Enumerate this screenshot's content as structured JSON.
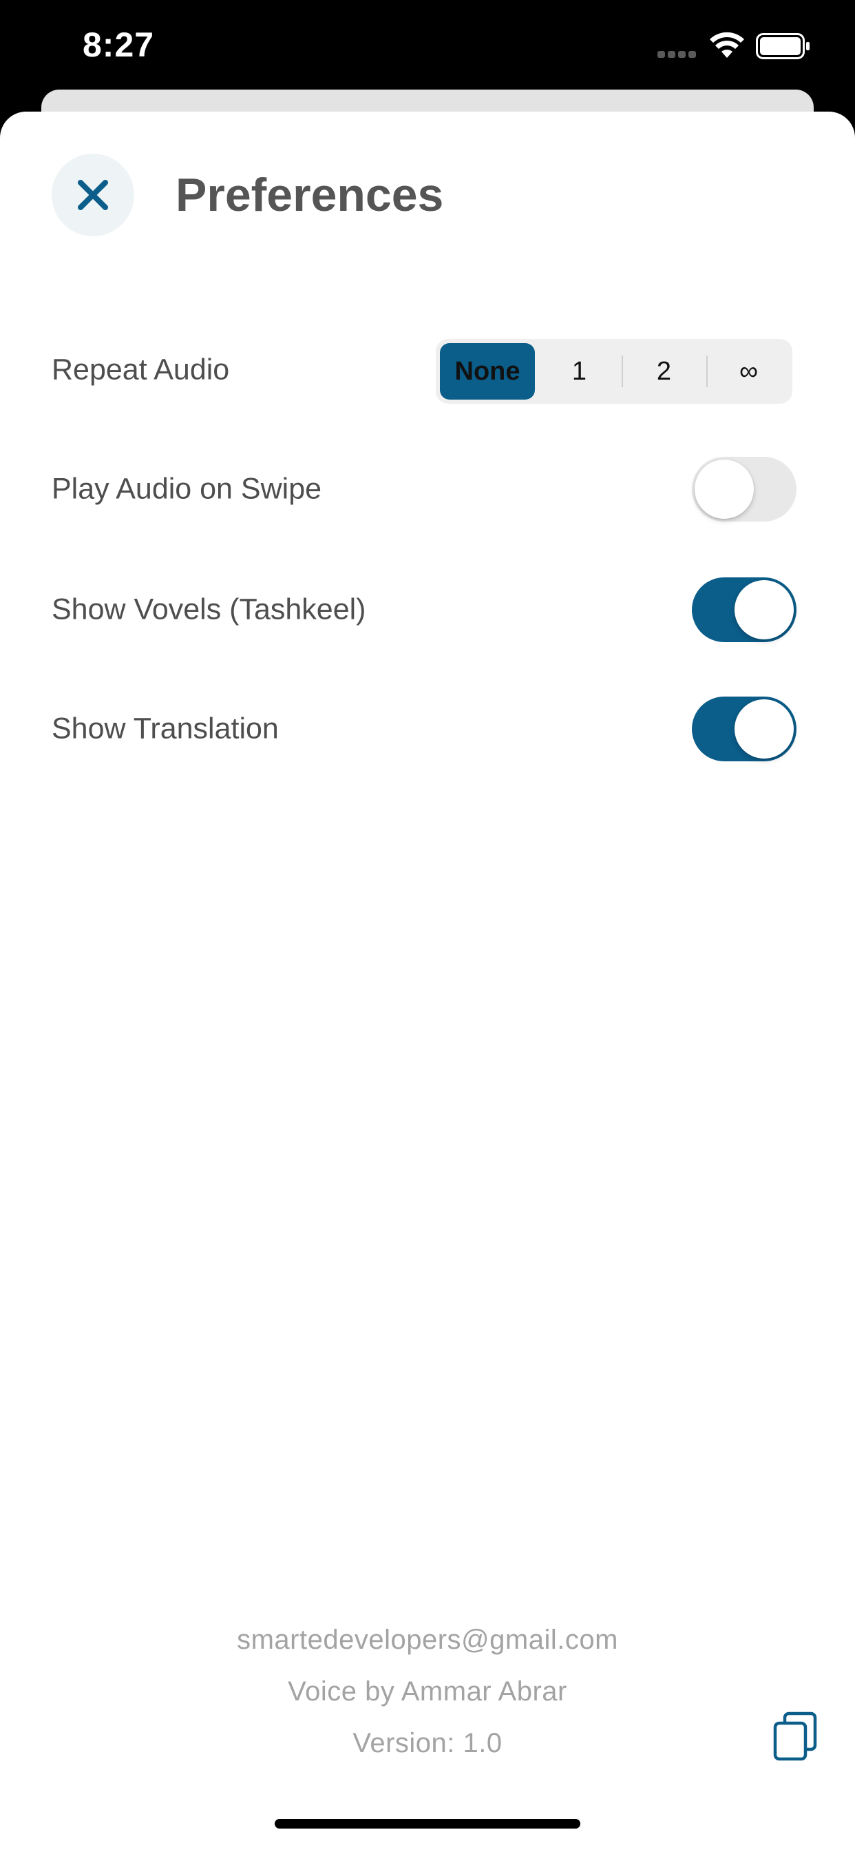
{
  "status_bar": {
    "time": "8:27"
  },
  "header": {
    "title": "Preferences",
    "close_icon": "close-icon"
  },
  "settings": {
    "repeat_audio": {
      "label": "Repeat Audio",
      "options": [
        "None",
        "1",
        "2",
        "∞"
      ],
      "selected": "None"
    },
    "play_on_swipe": {
      "label": "Play Audio on Swipe",
      "enabled": false
    },
    "show_vowels": {
      "label": "Show Vovels (Tashkeel)",
      "enabled": true
    },
    "show_translation": {
      "label": "Show Translation",
      "enabled": true
    }
  },
  "footer": {
    "email": "smartedevelopers@gmail.com",
    "voice_credit": "Voice by Ammar Abrar",
    "version": "Version: 1.0",
    "copy_icon": "copy-icon"
  },
  "colors": {
    "accent": "#0b5d8a",
    "toggle_off": "#e8e8e9",
    "title": "#555555",
    "footer_text": "#a3a3a3"
  }
}
